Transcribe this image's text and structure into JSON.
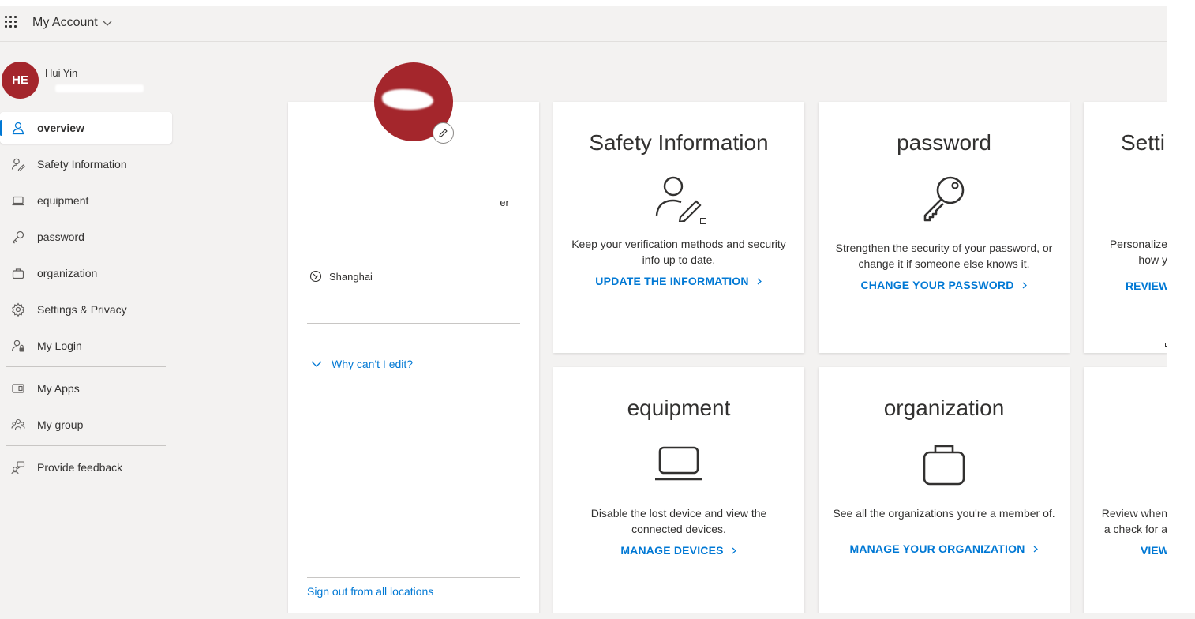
{
  "header": {
    "title": "My Account"
  },
  "user": {
    "initials": "HE",
    "name": "Hui Yin",
    "email": ""
  },
  "nav": {
    "items": [
      {
        "id": "overview",
        "label": "overview"
      },
      {
        "id": "safety",
        "label": "Safety Information"
      },
      {
        "id": "equipment",
        "label": "equipment"
      },
      {
        "id": "password",
        "label": "password"
      },
      {
        "id": "organization",
        "label": "organization"
      },
      {
        "id": "settings",
        "label": "Settings & Privacy"
      },
      {
        "id": "login",
        "label": "My Login"
      },
      {
        "id": "apps",
        "label": "My Apps"
      },
      {
        "id": "group",
        "label": "My group"
      },
      {
        "id": "feedback",
        "label": "Provide feedback"
      }
    ]
  },
  "profile": {
    "name": "",
    "job_title": "er",
    "email": "",
    "location": "Shanghai",
    "why_edit": "Why can't I edit?",
    "sign_out": "Sign out from all locations"
  },
  "tiles": {
    "safety": {
      "title": "Safety Information",
      "desc": "Keep your verification methods and security info up to date.",
      "link": "UPDATE THE INFORMATION"
    },
    "password": {
      "title": "password",
      "desc": "Strengthen the security of your password, or change it if someone else knows it.",
      "link": "CHANGE YOUR PASSWORD"
    },
    "settings": {
      "title": "Setti",
      "desc": "Personalize how y",
      "link": "REVIEW"
    },
    "equipment": {
      "title": "equipment",
      "desc": "Disable the lost device and view the connected devices.",
      "link": "MANAGE DEVICES"
    },
    "organization": {
      "title": "organization",
      "desc": "See all the organizations you're a member of.",
      "link": "MANAGE YOUR ORGANIZATION"
    },
    "login": {
      "desc": "Review when a check for a",
      "link": "VIEW"
    }
  },
  "colors": {
    "accent": "#0078d4",
    "avatar": "#a4262c",
    "background": "#f3f2f1"
  }
}
